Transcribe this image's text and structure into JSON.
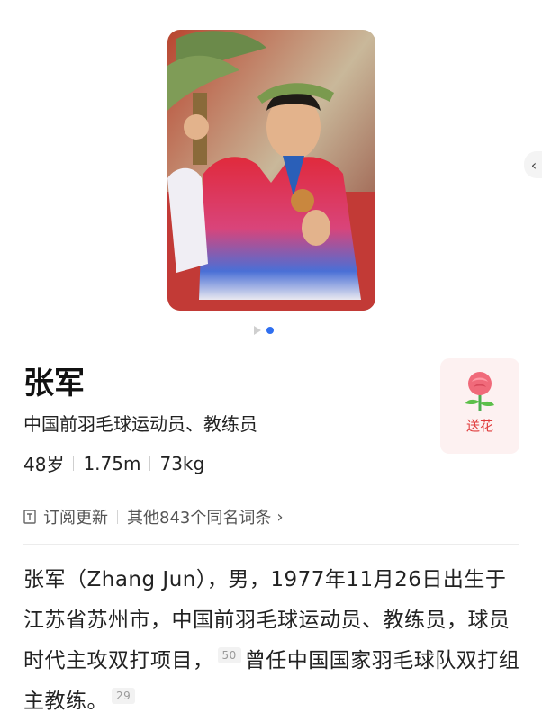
{
  "hero": {
    "image_alt": "人物照片",
    "carousel_active_index": 1,
    "carousel_count": 2
  },
  "person": {
    "name": "张军",
    "description": "中国前羽毛球运动员、教练员",
    "age": "48岁",
    "height": "1.75m",
    "weight": "73kg"
  },
  "flower_button": {
    "label": "送花",
    "icon": "rose-icon"
  },
  "meta": {
    "subscribe_label": "订阅更新",
    "other_entries_label": "其他843个同名词条",
    "subscribe_icon": "subscribe-icon",
    "chevron_icon": "chevron-right-icon"
  },
  "side_arrow": {
    "icon": "chevron-left-icon"
  },
  "intro": {
    "part1": "张军（Zhang Jun），男，1977年11月26日出生于江苏省苏州市，中国前羽毛球运动员、教练员，球员时代主攻双打项目，",
    "cite1": "50",
    "part2": "曾任中国国家羽毛球队双打组主教练。",
    "cite2": "29"
  },
  "colors": {
    "accent_blue": "#2f6ff0",
    "flower_red": "#e03c3c",
    "flower_bg": "#fdf1f1"
  }
}
